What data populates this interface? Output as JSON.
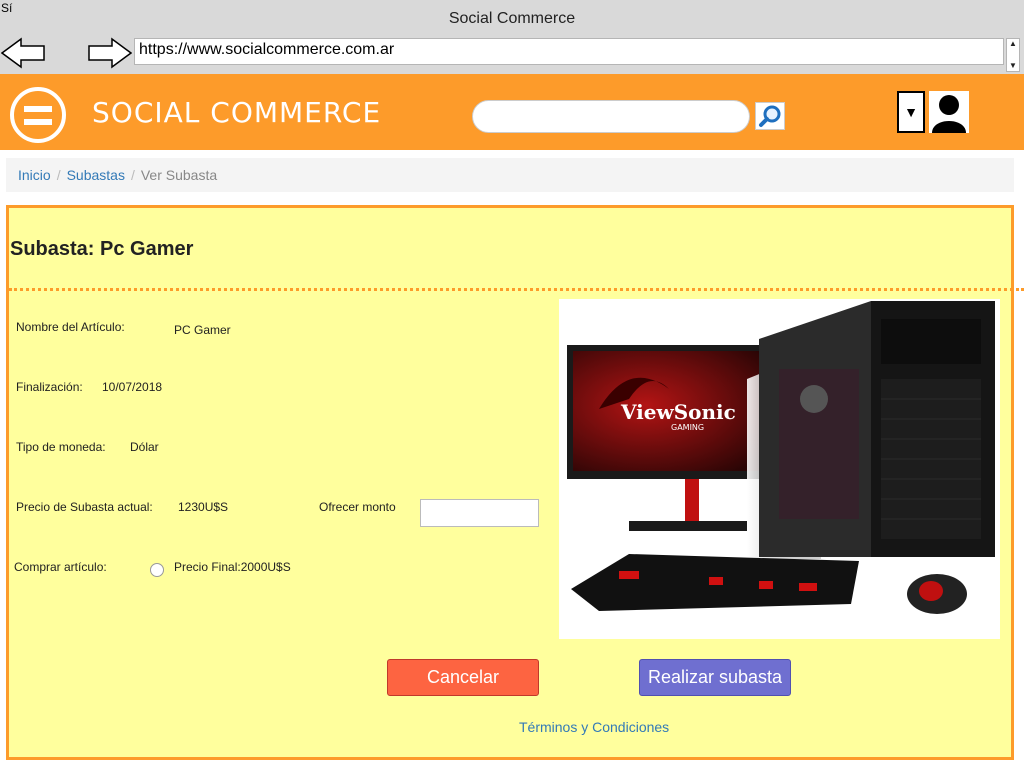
{
  "browser": {
    "corner_text": "Sí",
    "title": "Social Commerce",
    "url": "https://www.socialcommerce.com.ar",
    "back_icon": "back-arrow-icon",
    "forward_icon": "forward-arrow-icon"
  },
  "header": {
    "brand": "SOCIAL COMMERCE",
    "menu_icon": "hamburger-menu-icon",
    "search_placeholder": "",
    "search_icon": "magnifier-icon",
    "dropdown_glyph": "▼",
    "avatar_icon": "user-avatar-icon",
    "color": "#fd9b2a"
  },
  "breadcrumb": {
    "items": [
      "Inicio",
      "Subastas"
    ],
    "active": "Ver Subasta",
    "separator": "/"
  },
  "main": {
    "title": "Subasta: Pc Gamer",
    "fields": {
      "item_name_label": "Nombre del Artículo:",
      "item_name_value": "PC Gamer",
      "end_label": "Finalización:",
      "end_value": "10/07/2018",
      "currency_label": "Tipo de moneda:",
      "currency_value": "Dólar",
      "current_price_label": "Precio de Subasta actual:",
      "current_price_value": "1230U$S",
      "offer_label": "Ofrecer monto",
      "offer_value": "",
      "buy_label": "Comprar artículo:",
      "final_price_label": "Precio Final:2000U$S"
    },
    "image": {
      "brand_text": "ViewSonic",
      "sub_text": "GAMING"
    },
    "buttons": {
      "cancel": "Cancelar",
      "submit": "Realizar subasta"
    },
    "terms": "Términos y Condiciones",
    "background": "#ffff9d",
    "cancel_color": "#fd6441",
    "submit_color": "#6f6fd0"
  }
}
